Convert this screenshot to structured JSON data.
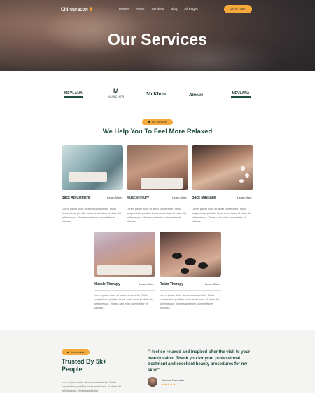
{
  "header": {
    "logo": "Chiropractor",
    "nav": [
      "Demos",
      "About",
      "Services",
      "Blog",
      "All Pages"
    ],
    "cta": "Get in Touch"
  },
  "hero": {
    "title": "Our Services"
  },
  "brands": {
    "b1": "MEVLANA",
    "b2_mark": "M",
    "b2": "MUNCHER",
    "b3": "McKlein",
    "b4": "Amelie",
    "b5": "MEVLANA"
  },
  "services": {
    "pill": "Our Services",
    "title": "We Help You To Feel More Relaxed",
    "more_label": "Learn More",
    "description": "Lorem ipsum dolor sit amet consectetur. Tellus suspendisse porttitor turpis amet lacus id etiam dui pellentesque. Viverra sed enim consectetur et ultricies...",
    "items": [
      {
        "title": "Back Adjustment"
      },
      {
        "title": "Muscle Injury"
      },
      {
        "title": "Back Massage"
      },
      {
        "title": "Muscle Therapy"
      },
      {
        "title": "Relax Therapy"
      }
    ]
  },
  "testimonials": {
    "pill": "Testimonials",
    "title": "Trusted By 5k+ People",
    "description": "Lorem ipsum dolor sit amet consectetur. Tellus suspendisse porttitor turpis amet lacus id etiam dui pellentesque. Viverra sed enim",
    "quote": "\"I feel so relaxed and inspired after the visit to your beauty salon! Thank you for your professional treatment and excellent beauty procedures for my skin!\"",
    "author_name": "Darlene Robertson",
    "stars": "★★★★★"
  },
  "colors": {
    "accent": "#f5a93a",
    "brand_green": "#1c4a3a"
  }
}
